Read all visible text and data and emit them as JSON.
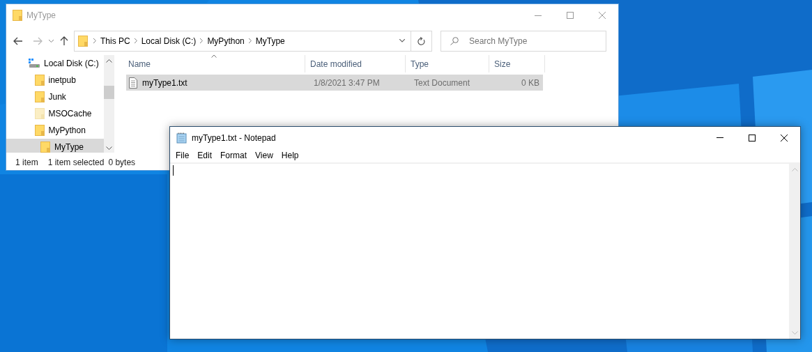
{
  "explorer": {
    "title": "MyType",
    "address": {
      "segments": [
        "This PC",
        "Local Disk (C:)",
        "MyPython",
        "MyType"
      ]
    },
    "search": {
      "placeholder": "Search MyType"
    },
    "nav_tree": [
      {
        "label": "Local Disk (C:)",
        "kind": "drive",
        "selected": false,
        "hidden": false,
        "children": [
          {
            "label": "inetpub",
            "kind": "folder",
            "selected": false,
            "hidden": false
          },
          {
            "label": "Junk",
            "kind": "folder",
            "selected": false,
            "hidden": false
          },
          {
            "label": "MSOCache",
            "kind": "folder",
            "selected": false,
            "hidden": true
          },
          {
            "label": "MyPython",
            "kind": "folder",
            "selected": false,
            "hidden": false,
            "children": [
              {
                "label": "MyType",
                "kind": "folder",
                "selected": true,
                "hidden": false
              }
            ]
          }
        ]
      }
    ],
    "columns": [
      "Name",
      "Date modified",
      "Type",
      "Size"
    ],
    "rows": [
      {
        "name": "myType1.txt",
        "date_modified": "1/8/2021 3:47 PM",
        "type": "Text Document",
        "size": "0 KB",
        "selected": true
      }
    ],
    "status_bar": {
      "item_count": "1 item",
      "selection": "1 item selected",
      "size": "0 bytes"
    }
  },
  "notepad": {
    "title": "myType1.txt - Notepad",
    "menu": [
      "File",
      "Edit",
      "Format",
      "View",
      "Help"
    ]
  }
}
